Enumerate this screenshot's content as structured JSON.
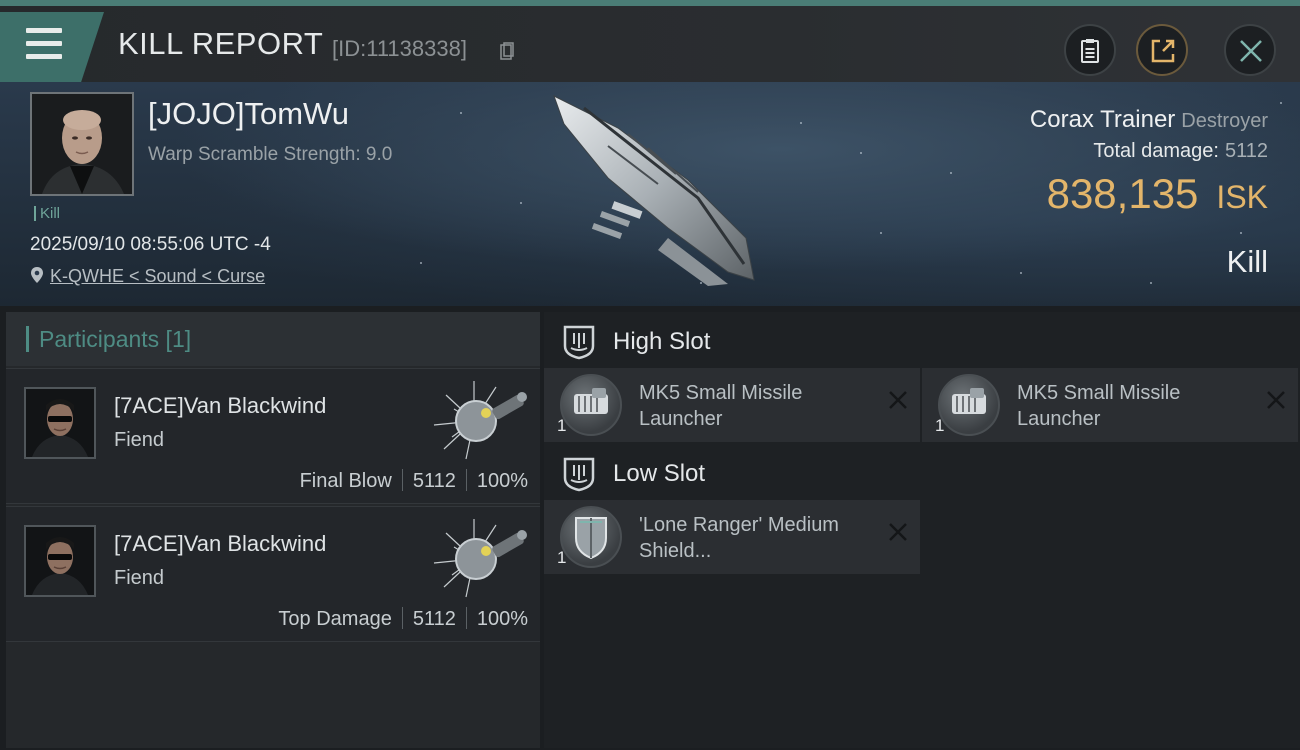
{
  "header": {
    "title": "KILL REPORT",
    "report_id": "[ID:11138338]",
    "icons": [
      "menu-icon",
      "copy-icon",
      "clipboard-icon",
      "share-icon",
      "close-icon"
    ]
  },
  "victim": {
    "name": "[JOJO]TomWu",
    "warp_scramble": "Warp Scramble Strength: 9.0",
    "tag": "Kill",
    "datetime": "2025/09/10 08:55:06 UTC -4",
    "location": "K-QWHE < Sound < Curse",
    "ship_name": "Corax Trainer",
    "ship_class": "Destroyer",
    "total_damage_label": "Total damage:",
    "total_damage_value": "5112",
    "isk_value": "838,135",
    "isk_unit": "ISK",
    "result": "Kill"
  },
  "participants": {
    "title": "Participants [1]",
    "rows": [
      {
        "name": "[7ACE]Van Blackwind",
        "ship": "Fiend",
        "role": "Final Blow",
        "damage": "5112",
        "percent": "100%"
      },
      {
        "name": "[7ACE]Van Blackwind",
        "ship": "Fiend",
        "role": "Top Damage",
        "damage": "5112",
        "percent": "100%"
      }
    ]
  },
  "fitting": {
    "high_slot_label": "High Slot",
    "low_slot_label": "Low Slot",
    "high_modules": [
      {
        "qty": "1",
        "name": "MK5 Small Missile Launcher"
      },
      {
        "qty": "1",
        "name": "MK5 Small Missile Launcher"
      }
    ],
    "low_modules": [
      {
        "qty": "1",
        "name": "'Lone Ranger' Medium Shield..."
      }
    ]
  },
  "colors": {
    "accent_teal": "#4e8c84",
    "isk_gold": "#e3b56a",
    "background": "#1b1e21"
  }
}
